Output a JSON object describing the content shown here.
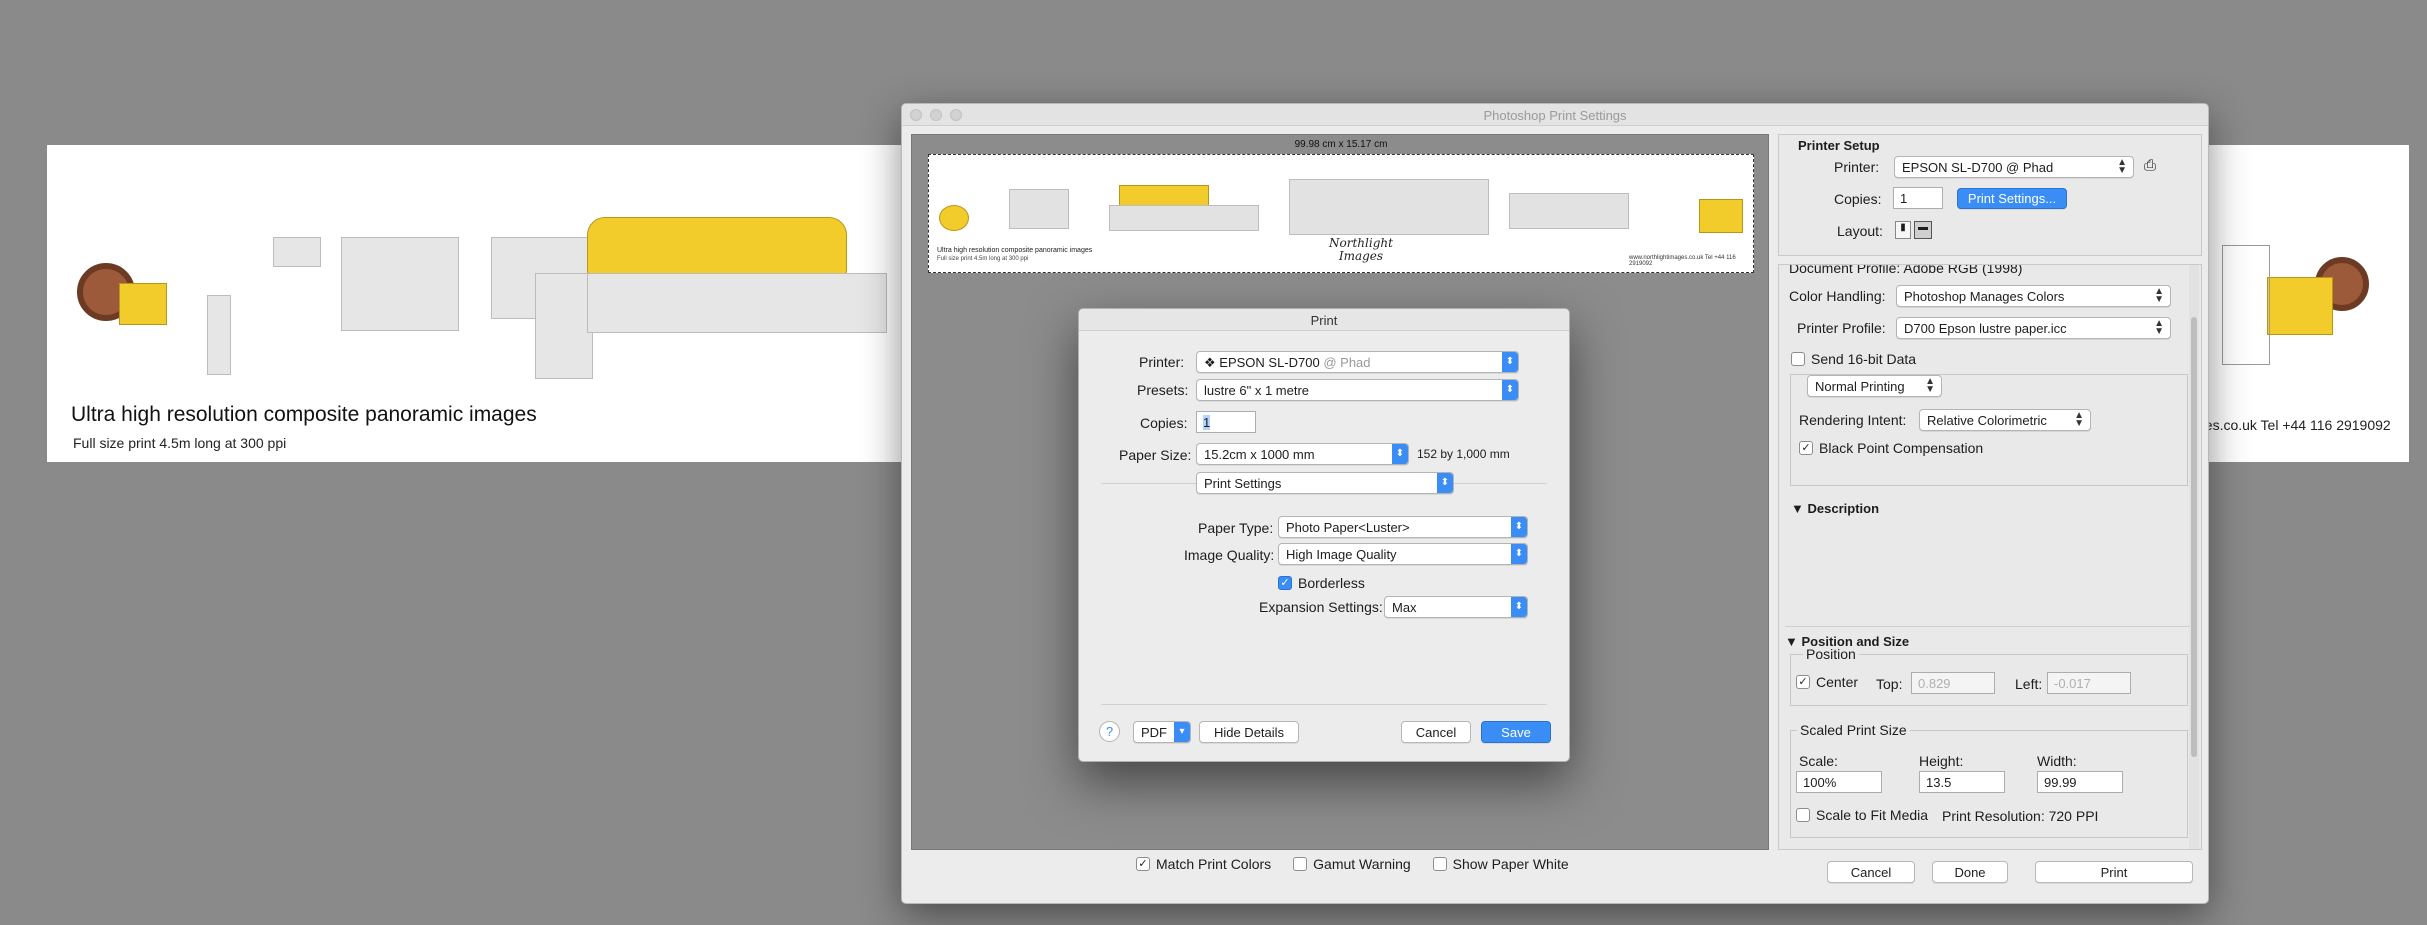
{
  "banner": {
    "title": "Ultra high resolution composite panoramic images",
    "subtitle": "Full size print 4.5m  long at 300 ppi",
    "contact": "ges.co.uk  Tel +44 116 2919092"
  },
  "window": {
    "title": "Photoshop Print Settings"
  },
  "preview": {
    "dimensions": "99.98 cm x 15.17 cm",
    "strip_text_1": "Ultra high resolution composite panoramic images",
    "strip_text_2": "Full size print 4.5m long at 300 ppi",
    "logo_line1": "Northlight",
    "logo_line2": "Images",
    "strip_contact": "www.northlightimages.co.uk  Tel +44 116 2919092"
  },
  "bottom_bar": {
    "match_print_colors": "Match Print Colors",
    "gamut_warning": "Gamut Warning",
    "show_paper_white": "Show Paper White",
    "cancel": "Cancel",
    "done": "Done",
    "print": "Print"
  },
  "printer_setup": {
    "section_title": "Printer Setup",
    "printer_label": "Printer:",
    "printer_value": "EPSON SL-D700 @ Phad",
    "copies_label": "Copies:",
    "copies_value": "1",
    "print_settings_button": "Print Settings...",
    "layout_label": "Layout:"
  },
  "color_management": {
    "document_profile": "Document Profile: Adobe RGB (1998)",
    "color_handling_label": "Color Handling:",
    "color_handling_value": "Photoshop Manages Colors",
    "printer_profile_label": "Printer Profile:",
    "printer_profile_value": "D700 Epson lustre paper.icc",
    "send_16bit": "Send 16-bit Data",
    "normal_printing": "Normal Printing",
    "rendering_intent_label": "Rendering Intent:",
    "rendering_intent_value": "Relative Colorimetric",
    "black_point": "Black Point Compensation"
  },
  "description": {
    "title": "Description"
  },
  "position_size": {
    "title": "Position and Size",
    "position_label": "Position",
    "center": "Center",
    "top_label": "Top:",
    "top_value": "0.829",
    "left_label": "Left:",
    "left_value": "-0.017",
    "scaled_label": "Scaled Print Size",
    "scale_label": "Scale:",
    "scale_value": "100%",
    "height_label": "Height:",
    "height_value": "13.5",
    "width_label": "Width:",
    "width_value": "99.99",
    "scale_to_fit": "Scale to Fit Media",
    "print_resolution": "Print Resolution: 720 PPI"
  },
  "print_dialog": {
    "title": "Print",
    "printer_label": "Printer:",
    "printer_name": "EPSON SL-D700",
    "printer_host": "@ Phad",
    "presets_label": "Presets:",
    "presets_value": "lustre 6\" x 1 metre",
    "copies_label": "Copies:",
    "copies_value": "1",
    "paper_size_label": "Paper Size:",
    "paper_size_value": "15.2cm x 1000 mm",
    "paper_size_hint": "152 by 1,000 mm",
    "section_value": "Print Settings",
    "paper_type_label": "Paper Type:",
    "paper_type_value": "Photo Paper<Luster>",
    "image_quality_label": "Image Quality:",
    "image_quality_value": "High Image Quality",
    "borderless": "Borderless",
    "expansion_label": "Expansion Settings:",
    "expansion_value": "Max",
    "help": "?",
    "pdf": "PDF",
    "hide_details": "Hide Details",
    "cancel": "Cancel",
    "save": "Save"
  },
  "colors": {
    "accent": "#3a8df5",
    "background": "#8a8a8a",
    "panel": "#ececec"
  }
}
